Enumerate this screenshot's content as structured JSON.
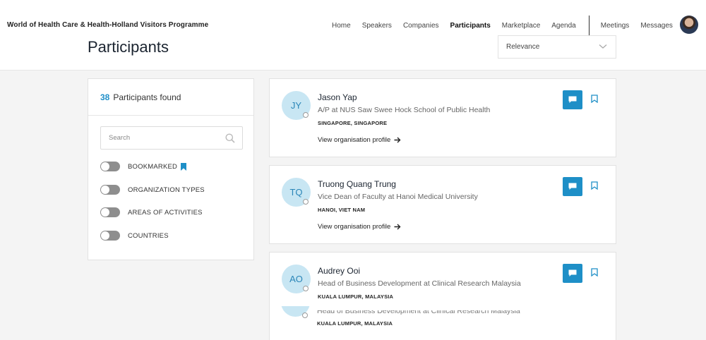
{
  "header": {
    "site_title": "World of Health Care & Health-Holland Visitors Programme",
    "nav": [
      "Home",
      "Speakers",
      "Companies",
      "Participants",
      "Marketplace",
      "Agenda"
    ],
    "nav_right": [
      "Meetings",
      "Messages"
    ],
    "active_nav": "Participants"
  },
  "page": {
    "title": "Participants",
    "sort_value": "Relevance"
  },
  "filters": {
    "count": "38",
    "found_label": "Participants found",
    "search_placeholder": "Search",
    "toggles": [
      "BOOKMARKED",
      "ORGANIZATION TYPES",
      "AREAS OF ACTIVITIES",
      "COUNTRIES"
    ]
  },
  "participants": [
    {
      "initials": "JY",
      "name": "Jason Yap",
      "role": "A/P at NUS Saw Swee Hock School of Public Health",
      "location": "SINGAPORE, SINGAPORE",
      "link": "View organisation profile"
    },
    {
      "initials": "TQ",
      "name": "Truong Quang Trung",
      "role": "Vice Dean of Faculty at Hanoi Medical University",
      "location": "HANOI, VIET NAM",
      "link": "View organisation profile"
    },
    {
      "initials": "AO",
      "name": "Audrey Ooi",
      "role": "Head of Business Development at Clinical Research Malaysia",
      "location": "KUALA LUMPUR, MALAYSIA"
    }
  ],
  "ghost_row": {
    "role": "Head of Business Development at Clinical Research Malaysia",
    "location": "KUALA LUMPUR, MALAYSIA"
  },
  "colors": {
    "accent": "#1e8fc7",
    "initials_bg": "#c8e6f3",
    "toggle_off": "#8e8e8e"
  }
}
